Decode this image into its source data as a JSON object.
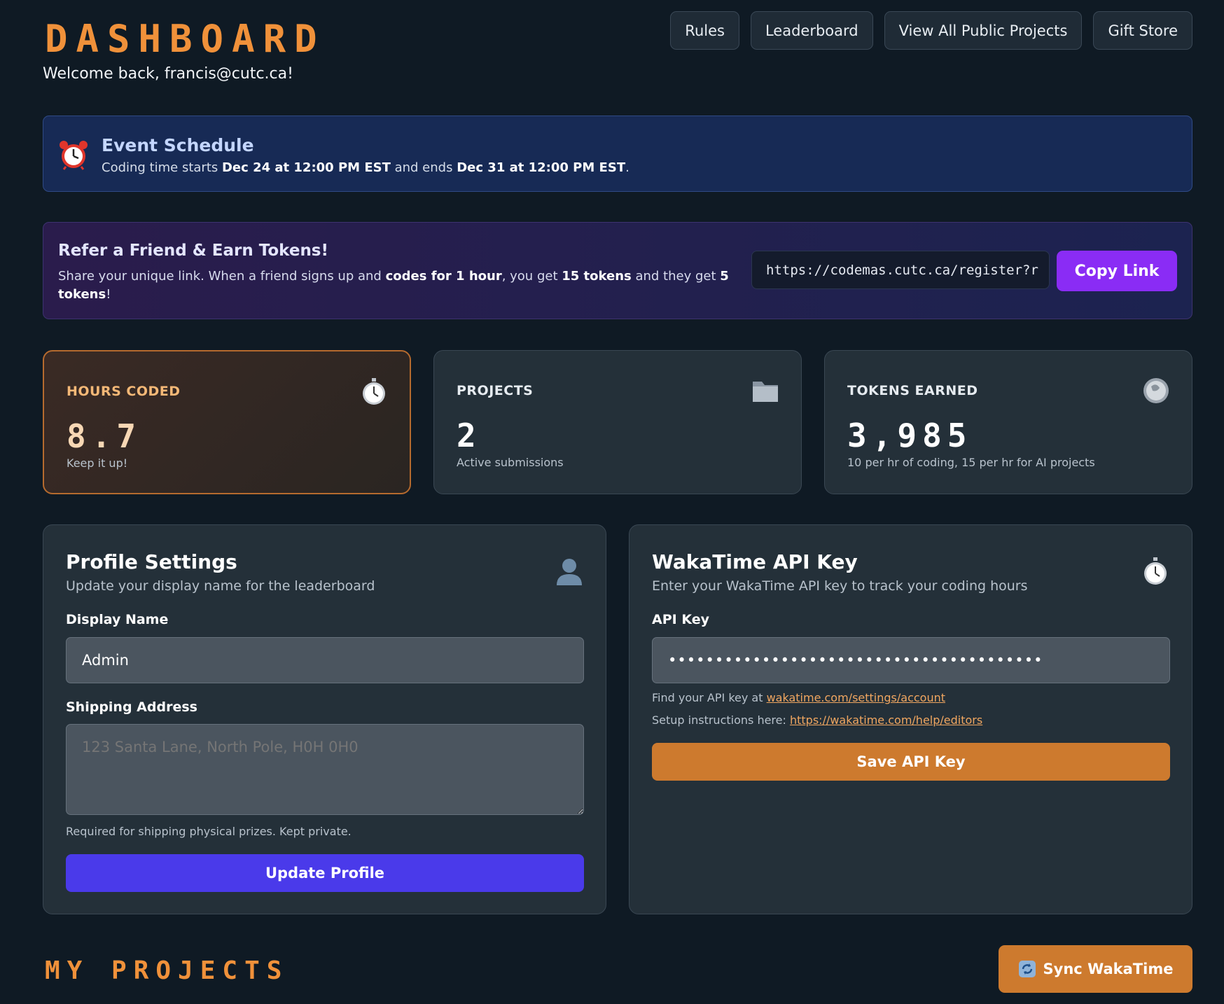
{
  "header": {
    "title": "DASHBOARD",
    "welcome": "Welcome back, francis@cutc.ca!",
    "nav": [
      "Rules",
      "Leaderboard",
      "View All Public Projects",
      "Gift Store"
    ]
  },
  "schedule": {
    "icon": "alarm-clock-icon",
    "title": "Event Schedule",
    "text1": "Coding time starts ",
    "start": "Dec 24 at 12:00 PM EST",
    "text2": " and ends ",
    "end": "Dec 31 at 12:00 PM EST",
    "text3": "."
  },
  "referral": {
    "title": "Refer a Friend & Earn Tokens!",
    "t1": "Share your unique link. When a friend signs up and ",
    "b1": "codes for 1 hour",
    "t2": ", you get ",
    "b2": "15 tokens",
    "t3": " and they get ",
    "b3": "5 tokens",
    "t4": "!",
    "link": "https://codemas.cutc.ca/register?r",
    "copy_label": "Copy Link"
  },
  "stats": [
    {
      "label": "HOURS CODED",
      "value": "8.7",
      "sub": "Keep it up!",
      "icon": "stopwatch-icon"
    },
    {
      "label": "PROJECTS",
      "value": "2",
      "sub": "Active submissions",
      "icon": "folder-icon"
    },
    {
      "label": "TOKENS EARNED",
      "value": "3,985",
      "sub": "10 per hr of coding, 15 per hr for AI projects",
      "icon": "coin-icon"
    }
  ],
  "profile": {
    "title": "Profile Settings",
    "subtitle": "Update your display name for the leaderboard",
    "display_name_label": "Display Name",
    "display_name_value": "Admin",
    "shipping_label": "Shipping Address",
    "shipping_placeholder": "123 Santa Lane, North Pole, H0H 0H0",
    "shipping_hint": "Required for shipping physical prizes. Kept private.",
    "button": "Update Profile"
  },
  "wakatime": {
    "title": "WakaTime API Key",
    "subtitle": "Enter your WakaTime API key to track your coding hours",
    "api_label": "API Key",
    "api_value": "••••••••••••••••••••••••••••••••••••••••",
    "hint1_text": "Find your API key at ",
    "hint1_link": "wakatime.com/settings/account",
    "hint2_text": "Setup instructions here: ",
    "hint2_link": "https://wakatime.com/help/editors",
    "button": "Save API Key"
  },
  "projects": {
    "title": "MY PROJECTS",
    "sync_label": "Sync WakaTime"
  },
  "colors": {
    "background": "#0f1a24",
    "accent_orange": "#f0913a",
    "purple_button": "#8a2cf5",
    "indigo_button": "#4a3aea",
    "orange_button": "#cd7a2e"
  }
}
